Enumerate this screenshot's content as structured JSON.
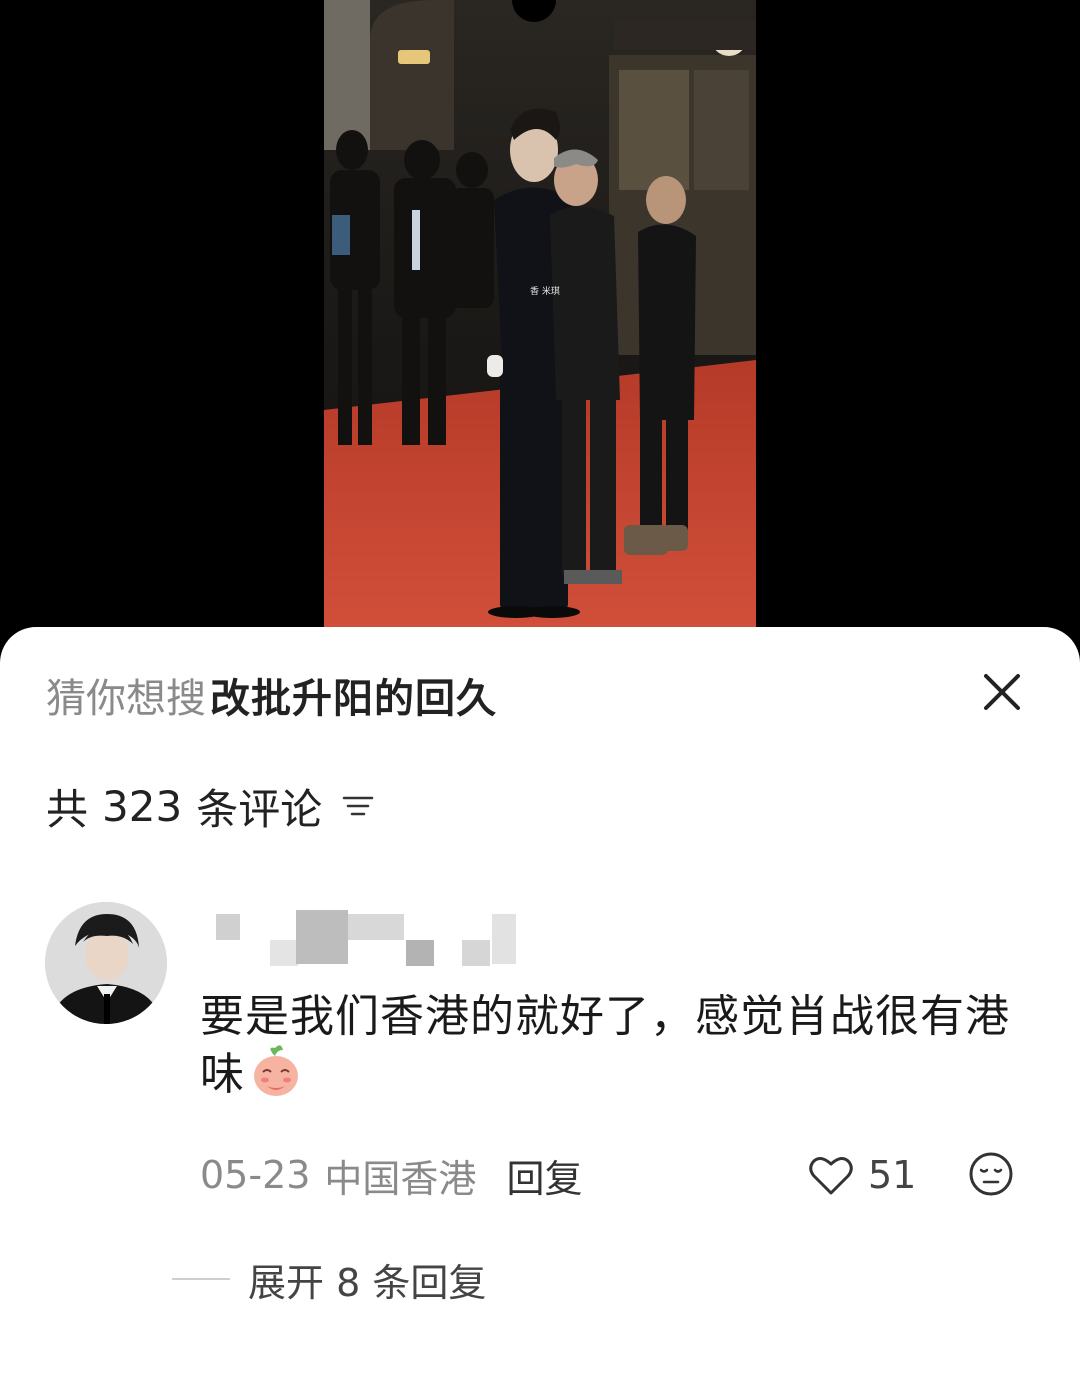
{
  "video": {
    "watermark_text": "香 米琪"
  },
  "search_suggestion": {
    "label": "猜你想搜",
    "term": "改批升阳的回久"
  },
  "comments_header": {
    "prefix": "共",
    "count": "323",
    "suffix": "条评论"
  },
  "comment": {
    "text": "要是我们香港的就好了，感觉肖战很有港味",
    "date": "05-23",
    "location": "中国香港",
    "reply_label": "回复",
    "likes": "51"
  },
  "replies": {
    "expand_label": "展开 8 条回复"
  },
  "colors": {
    "carpet": "#c8442e",
    "sheet_bg": "#ffffff",
    "secondary_text": "#8a8a8a"
  }
}
